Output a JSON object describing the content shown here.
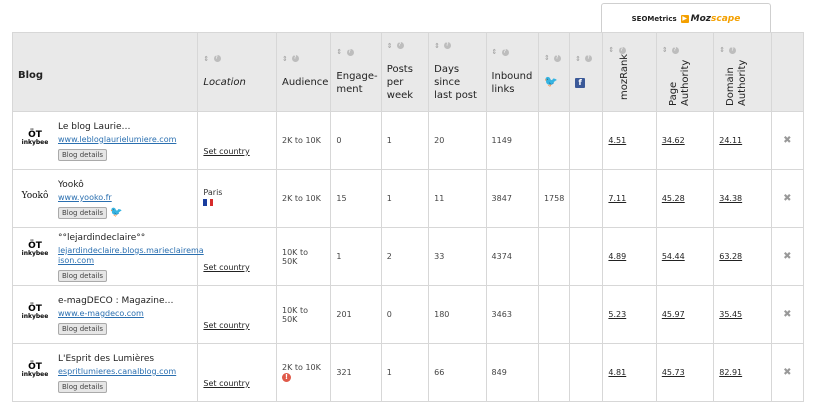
{
  "seo_header": {
    "label": "SEOMetrics",
    "brand_main": "Moz",
    "brand_accent": "scape"
  },
  "columns": {
    "blog": "Blog",
    "location": "Location",
    "audience": "Audience",
    "engagement": "Engage-ment",
    "posts_per_week": "Posts per week",
    "days_since_last_post": "Days since last post",
    "inbound_links": "Inbound links",
    "twitter": "twitter-icon",
    "facebook": "facebook-icon",
    "mozrank": "mozRank",
    "page_authority": "Page Authority",
    "domain_authority": "Domain Authority"
  },
  "rows": [
    {
      "logo": "inkybee",
      "name": "Le blog Laurie…",
      "url": "www.lebloglaurielumiere.com",
      "details_label": "Blog details",
      "twitter_badge": false,
      "location": "Set country",
      "location_is_link": true,
      "audience": "2K to 10K",
      "engagement": "0",
      "posts_per_week": "1",
      "days_since_last_post": "20",
      "inbound_links": "1149",
      "twitter": "",
      "facebook": "",
      "mozrank": "4.51",
      "page_authority": "34.62",
      "domain_authority": "24.11"
    },
    {
      "logo": "yooko",
      "name": "Yookô",
      "url": "www.yooko.fr",
      "details_label": "Blog details",
      "twitter_badge": true,
      "location": "Paris",
      "location_is_link": false,
      "audience": "2K to 10K",
      "engagement": "15",
      "posts_per_week": "1",
      "days_since_last_post": "11",
      "inbound_links": "3847",
      "twitter": "1758",
      "facebook": "",
      "mozrank": "7.11",
      "page_authority": "45.28",
      "domain_authority": "34.38"
    },
    {
      "logo": "inkybee",
      "name": "°°lejardindeclaire°°",
      "url": "lejardindeclaire.blogs.marieclairema ison.com",
      "details_label": "Blog details",
      "twitter_badge": false,
      "location": "Set country",
      "location_is_link": true,
      "audience": "10K to 50K",
      "engagement": "1",
      "posts_per_week": "2",
      "days_since_last_post": "33",
      "inbound_links": "4374",
      "twitter": "",
      "facebook": "",
      "mozrank": "4.89",
      "page_authority": "54.44",
      "domain_authority": "63.28"
    },
    {
      "logo": "inkybee",
      "name": "e-magDECO : Magazine…",
      "url": "www.e-magdeco.com",
      "details_label": "Blog details",
      "twitter_badge": false,
      "location": "Set country",
      "location_is_link": true,
      "audience": "10K to 50K",
      "engagement": "201",
      "posts_per_week": "0",
      "days_since_last_post": "180",
      "inbound_links": "3463",
      "twitter": "",
      "facebook": "",
      "mozrank": "5.23",
      "page_authority": "45.97",
      "domain_authority": "35.45"
    },
    {
      "logo": "inkybee",
      "name": "L'Esprit des Lumières",
      "url": "espritlumieres.canalblog.com",
      "details_label": "Blog details",
      "twitter_badge": false,
      "location": "Set country",
      "location_is_link": true,
      "audience": "2K to 10K",
      "audience_warning": true,
      "engagement": "321",
      "posts_per_week": "1",
      "days_since_last_post": "66",
      "inbound_links": "849",
      "twitter": "",
      "facebook": "",
      "mozrank": "4.81",
      "page_authority": "45.73",
      "domain_authority": "82.91"
    }
  ],
  "logos": {
    "inkybee_text": "inkybee",
    "yooko_text": "Yookô"
  },
  "colors": {
    "accent": "#f4a000",
    "link": "#2a6fb0",
    "twitter": "#2b9ee0",
    "facebook": "#3b5998",
    "warning": "#e05a4a"
  }
}
